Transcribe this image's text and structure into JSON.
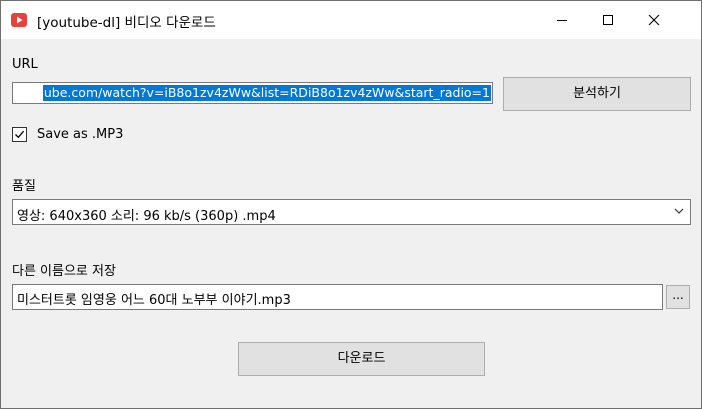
{
  "window": {
    "title": "[youtube-dl]  비디오 다운로드",
    "app_icon": "youtube-play-icon",
    "accent_color": "#e8413c"
  },
  "url": {
    "label": "URL",
    "value": "ube.com/watch?v=iB8o1zv4zWw&list=RDiB8o1zv4zWw&start_radio=1",
    "selection_color": "#0078d7"
  },
  "analyze_button": {
    "label": "분석하기"
  },
  "mp3": {
    "label": "Save as .MP3",
    "checked": true
  },
  "quality": {
    "label": "품질",
    "selected": "영상: 640x360 소리:  96 kb/s (360p) .mp4"
  },
  "save_as": {
    "label": "다른 이름으로 저장",
    "value": "미스터트롯 임영웅 어느 60대 노부부 이야기.mp3",
    "browse_label": "..."
  },
  "download_button": {
    "label": "다운로드"
  }
}
